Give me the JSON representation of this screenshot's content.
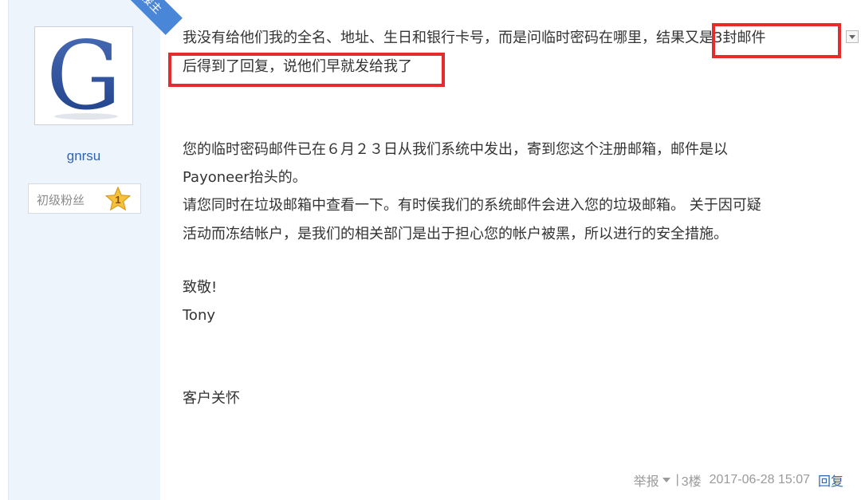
{
  "post": {
    "badge": "楼主",
    "author": {
      "username": "gnrsu",
      "rank_label": "初级粉丝",
      "rank_level": "1",
      "avatar_letter": "G"
    },
    "body": {
      "line1_prefix": "我没有给他们我的全名、地址、生日和银行卡号，而是问临时密码在哪里，",
      "line1_highlight": "结果又是3封邮件",
      "line2_highlight": "后得到了回复，说他们早就发给我了",
      "para1_line1": "您的临时密码邮件已在６月２３日从我们系统中发出，寄到您这个注册邮箱，邮件是以",
      "para1_line2": "Payoneer抬头的。",
      "para2_line1": "请您同时在垃圾邮箱中查看一下。有时侯我们的系统邮件会进入您的垃圾邮箱。 关于因可疑",
      "para2_line2": "活动而冻结帐户，是我们的相关部门是出于担心您的帐户被黑，所以进行的安全措施。",
      "greeting": "致敬!",
      "signature": "Tony",
      "department": "客户关怀"
    },
    "footer": {
      "report": "举报",
      "separator": "|",
      "floor": "3楼",
      "timestamp": "2017-06-28 15:07",
      "reply": "回复"
    }
  },
  "colors": {
    "highlight_border": "#e52b2b",
    "link": "#2d64b3",
    "badge": "#4a86d8",
    "sidebar_bg": "#eef4fb"
  }
}
